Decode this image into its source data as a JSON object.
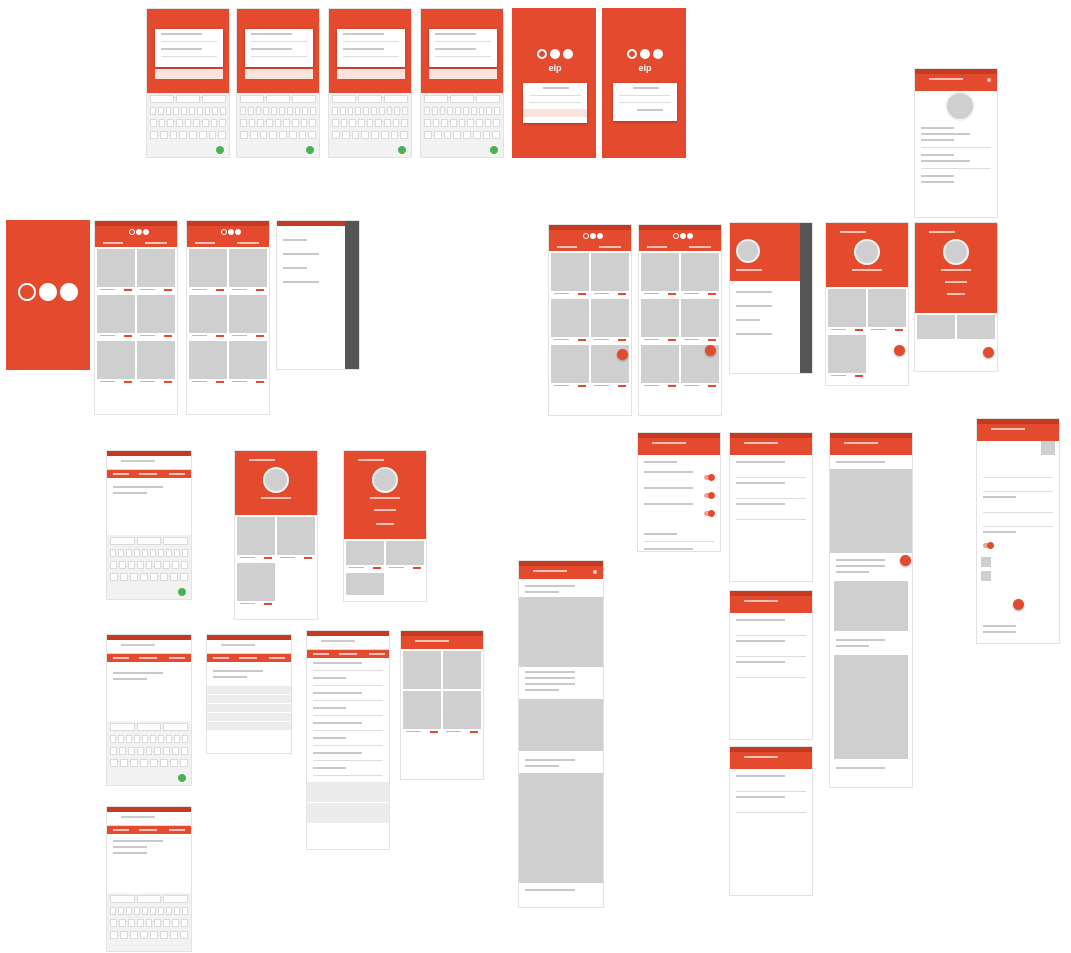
{
  "title": "",
  "brand": {
    "primary_color": "#e44a2e",
    "logo_word": "eip"
  }
}
